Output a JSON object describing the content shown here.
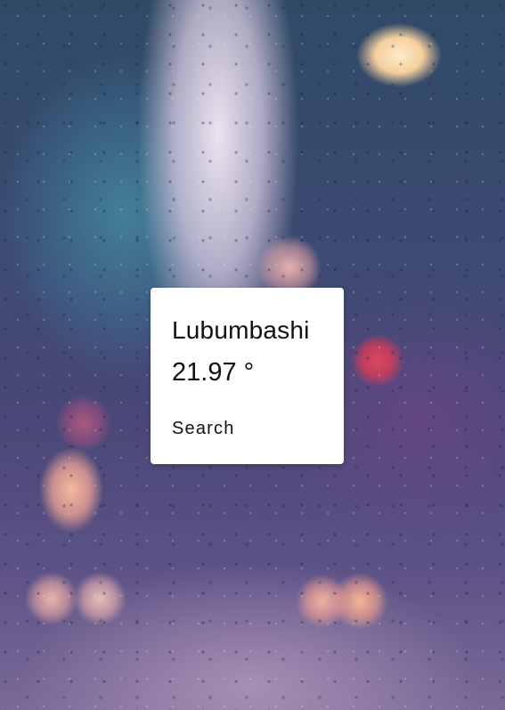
{
  "weather": {
    "city": "Lubumbashi",
    "temperature": "21.97 °"
  },
  "actions": {
    "search_label": "Search"
  },
  "background": {
    "scene": "rainy-window-bokeh",
    "palette": [
      "#2f4a66",
      "#4a4878",
      "#7a6a98",
      "#f5ebf5"
    ]
  }
}
